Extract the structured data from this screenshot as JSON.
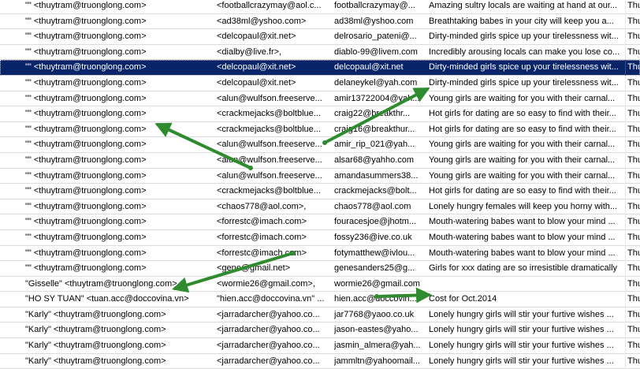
{
  "colors": {
    "arrow": "#2e8b2e",
    "selection": "#0a246a"
  },
  "icon": "envelope-icon",
  "rows": [
    {
      "from": "\"\" <thuytram@truonglong.com>",
      "to": "<footballcrazymay@aol.c...",
      "reply_to": "footballcrazymay@...",
      "subject": "Amazing sultry locals are waiting at hand at our...",
      "date": "Thu"
    },
    {
      "from": "\"\" <thuytram@truonglong.com>",
      "to": "<ad38ml@yshoo.com>",
      "reply_to": "ad38ml@yshoo.com",
      "subject": "Breathtaking babes in your city will keep you a...",
      "date": "Thu"
    },
    {
      "from": "\"\" <thuytram@truonglong.com>",
      "to": "<delcopaul@xit.net>",
      "reply_to": "delrosario_pateni@...",
      "subject": "Dirty-minded girls spice up your tirelessness wit...",
      "date": "Thu"
    },
    {
      "from": "\"\" <thuytram@truonglong.com>",
      "to": "<dialby@live.fr>,",
      "reply_to": "diablo-99@livem.com",
      "subject": "Incredibly arousing locals can make you lose co...",
      "date": "Thu"
    },
    {
      "from": "\"\" <thuytram@truonglong.com>",
      "to": "<delcopaul@xit.net>",
      "reply_to": "delcopaul@xit.net",
      "subject": "Dirty-minded girls spice up your tirelessness wit...",
      "date": "Thu",
      "selected": true
    },
    {
      "from": "\"\" <thuytram@truonglong.com>",
      "to": "<delcopaul@xit.net>",
      "reply_to": "delaneykel@yah.com",
      "subject": "Dirty-minded girls spice up your tirelessness wit...",
      "date": "Thu"
    },
    {
      "from": "\"\" <thuytram@truonglong.com>",
      "to": "<alun@wulfson.freeserve...",
      "reply_to": "amir13722004@yah...",
      "subject": "Young girls are waiting for you with their carnal...",
      "date": "Thu"
    },
    {
      "from": "\"\" <thuytram@truonglong.com>",
      "to": "<crackmejacks@boltblue...",
      "reply_to": "craig22@breakthr...",
      "subject": "Hot girls for dating are so easy to find with their...",
      "date": "Thu"
    },
    {
      "from": "\"\" <thuytram@truonglong.com>",
      "to": "<crackmejacks@boltblue...",
      "reply_to": "craig16@breakthur...",
      "subject": "Hot girls for dating are so easy to find with their...",
      "date": "Thu"
    },
    {
      "from": "\"\" <thuytram@truonglong.com>",
      "to": "<alun@wulfson.freeserve...",
      "reply_to": "amir_rip_021@yah...",
      "subject": "Young girls are waiting for you with their carnal...",
      "date": "Thu"
    },
    {
      "from": "\"\" <thuytram@truonglong.com>",
      "to": "<alun@wulfson.freeserve...",
      "reply_to": "alsar68@yahho.com",
      "subject": "Young girls are waiting for you with their carnal...",
      "date": "Thu"
    },
    {
      "from": "\"\" <thuytram@truonglong.com>",
      "to": "<alun@wulfson.freeserve...",
      "reply_to": "amandasummers38...",
      "subject": "Young girls are waiting for you with their carnal...",
      "date": "Thu"
    },
    {
      "from": "\"\" <thuytram@truonglong.com>",
      "to": "<crackmejacks@boltblue...",
      "reply_to": "crackmejacks@bolt...",
      "subject": "Hot girls for dating are so easy to find with their...",
      "date": "Thu"
    },
    {
      "from": "\"\" <thuytram@truonglong.com>",
      "to": "<chaos778@aol.com>,",
      "reply_to": "chaos778@aol.com",
      "subject": "Lonely hungry females will keep you horny with...",
      "date": "Thu"
    },
    {
      "from": "\"\" <thuytram@truonglong.com>",
      "to": "<forrestc@imach.com>",
      "reply_to": "fouracesjoe@jhotm...",
      "subject": "Mouth-watering babes want to blow your mind ...",
      "date": "Thu"
    },
    {
      "from": "\"\" <thuytram@truonglong.com>",
      "to": "<forrestc@imach.com>",
      "reply_to": "fossy236@ive.co.uk",
      "subject": "Mouth-watering babes want to blow your mind ...",
      "date": "Thu"
    },
    {
      "from": "\"\" <thuytram@truonglong.com>",
      "to": "<forrestc@imach.com>",
      "reply_to": "fotymatthew@ivlou...",
      "subject": "Mouth-watering babes want to blow your mind ...",
      "date": "Thu"
    },
    {
      "from": "\"\" <thuytram@truonglong.com>",
      "to": "<gene@gmail.net>",
      "reply_to": "genesanders25@g...",
      "subject": "Girls for xxx dating are so irresistible dramatically",
      "date": "Thu"
    },
    {
      "from": "\"Gisselle\" <thuytram@truonglong.com>",
      "to": "<wormie26@gmail.com>,",
      "reply_to": "wormie26@gmail.com",
      "subject": "",
      "date": "Thu"
    },
    {
      "from": "\"HO SY TUAN\" <tuan.acc@doccovina.vn>",
      "to": "\"hien.acc@doccovina.vn\" ...",
      "reply_to": "hien.acc@doccovin...",
      "subject": "Cost for Oct.2014",
      "date": "Thu"
    },
    {
      "from": "\"Karly\" <thuytram@truonglong.com>",
      "to": "<jarradarcher@yahoo.co...",
      "reply_to": "jar7768@yaoo.co.uk",
      "subject": "Lonely hungry girls will stir your furtive wishes ...",
      "date": "Thu"
    },
    {
      "from": "\"Karly\" <thuytram@truonglong.com>",
      "to": "<jarradarcher@yahoo.co...",
      "reply_to": "jason-eastes@yaho...",
      "subject": "Lonely hungry girls will stir your furtive wishes ...",
      "date": "Thu"
    },
    {
      "from": "\"Karly\" <thuytram@truonglong.com>",
      "to": "<jarradarcher@yahoo.co...",
      "reply_to": "jasmin_almera@yah...",
      "subject": "Lonely hungry girls will stir your furtive wishes ...",
      "date": "Thu"
    },
    {
      "from": "\"Karly\" <thuytram@truonglong.com>",
      "to": "<jarradarcher@yahoo.co...",
      "reply_to": "jammltn@yahoomail...",
      "subject": "Lonely hungry girls will stir your furtive wishes ...",
      "date": "Thu"
    }
  ]
}
